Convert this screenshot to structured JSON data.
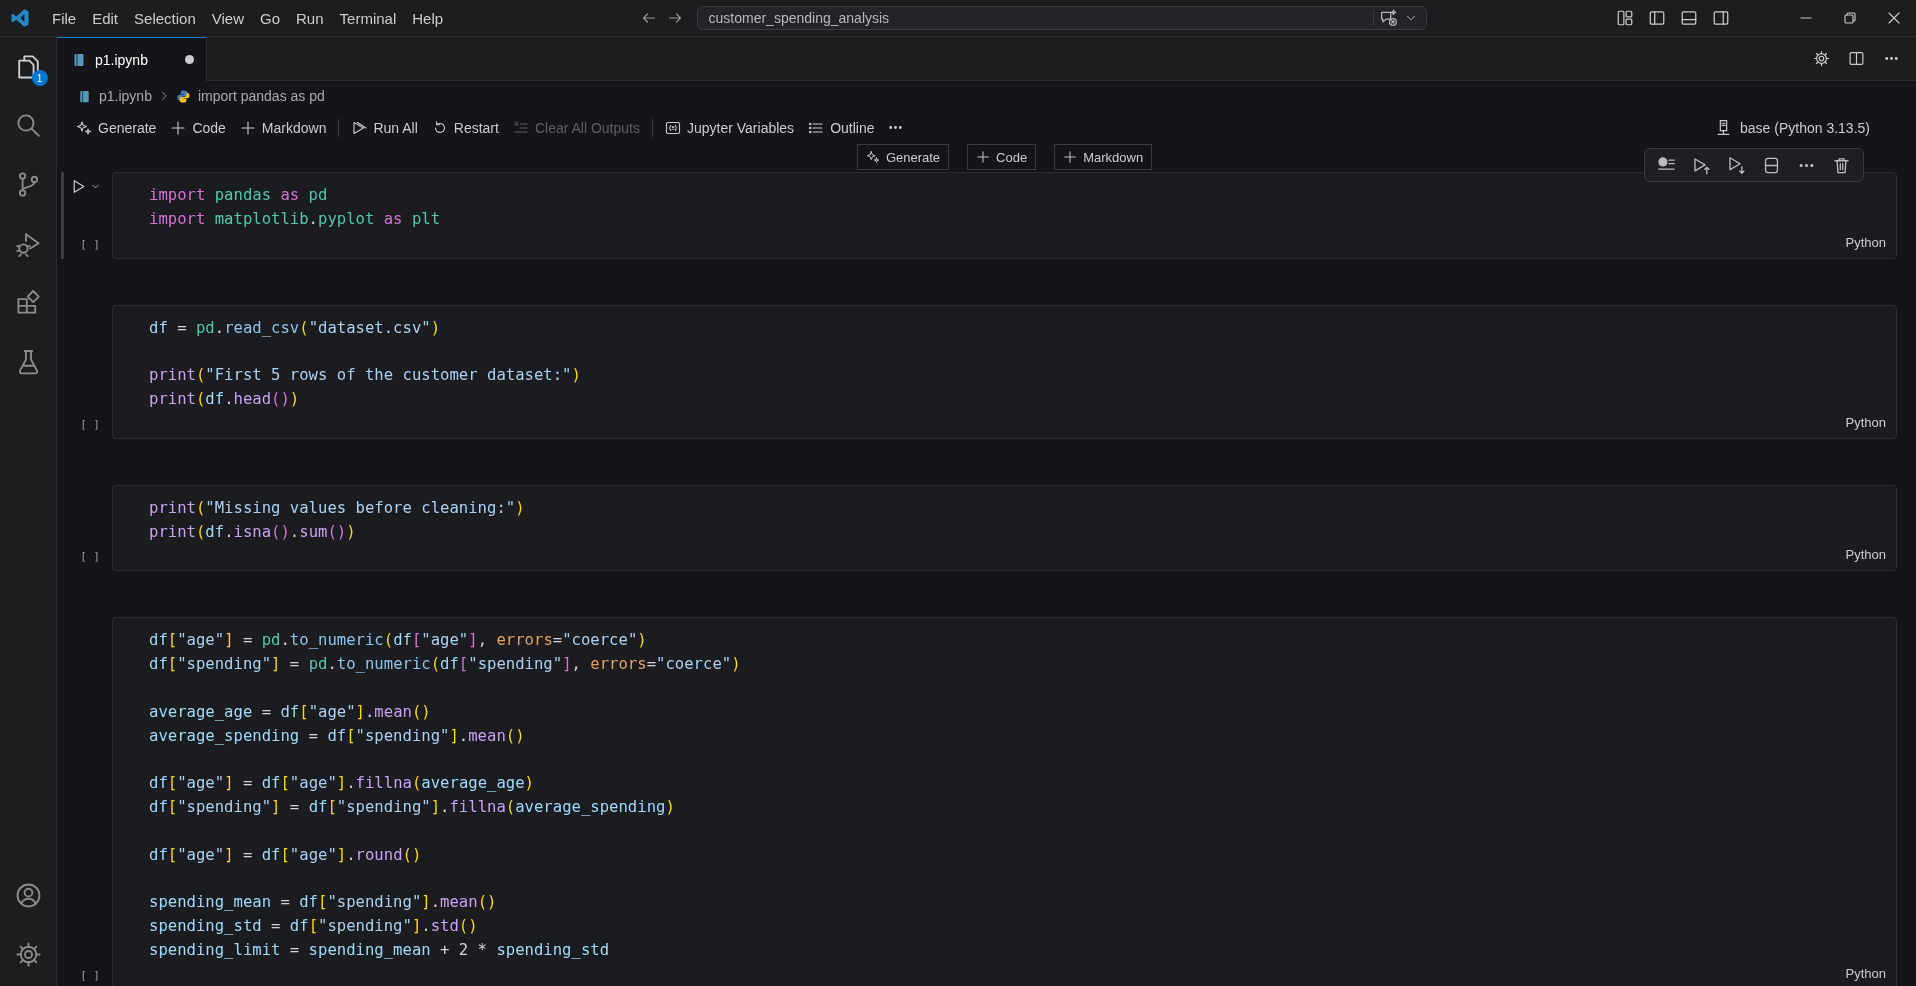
{
  "title_bar": {
    "menu": [
      "File",
      "Edit",
      "Selection",
      "View",
      "Go",
      "Run",
      "Terminal",
      "Help"
    ],
    "search": "customer_spending_analysis"
  },
  "activity_bar": {
    "explorer_badge": "1"
  },
  "tab": {
    "label": "p1.ipynb",
    "modified": true
  },
  "breadcrumb": [
    "p1.ipynb",
    "import pandas as pd"
  ],
  "toolbar": {
    "groups": [
      [
        {
          "kind": "generate",
          "label": "Generate",
          "disabled": false
        },
        {
          "kind": "code",
          "label": "Code",
          "disabled": false
        },
        {
          "kind": "markdown",
          "label": "Markdown",
          "disabled": false
        }
      ],
      [
        {
          "kind": "run_all",
          "label": "Run All",
          "disabled": false
        },
        {
          "kind": "restart",
          "label": "Restart",
          "disabled": false
        },
        {
          "kind": "clear",
          "label": "Clear All Outputs",
          "disabled": true
        }
      ],
      [
        {
          "kind": "variables",
          "label": "Jupyter Variables",
          "disabled": false
        },
        {
          "kind": "outline",
          "label": "Outline",
          "disabled": false
        }
      ]
    ],
    "kernel": "base (Python 3.13.5)"
  },
  "insert_bar": [
    {
      "kind": "generate",
      "label": "Generate"
    },
    {
      "kind": "code",
      "label": "Code"
    },
    {
      "kind": "markdown",
      "label": "Markdown"
    }
  ],
  "cells": [
    {
      "focused": true,
      "execution": "[ ]",
      "language": "Python",
      "lines": [
        {
          "kind": "code",
          "tokens": [
            {
              "kind": "kw",
              "text": "import "
            },
            {
              "kind": "mod",
              "text": "pandas "
            },
            {
              "kind": "kw",
              "text": "as "
            },
            {
              "kind": "mod",
              "text": "pd"
            }
          ]
        },
        {
          "kind": "code",
          "tokens": [
            {
              "kind": "kw",
              "text": "import "
            },
            {
              "kind": "mod",
              "text": "matplotlib"
            },
            {
              "kind": "op",
              "text": "."
            },
            {
              "kind": "mod",
              "text": "pyplot "
            },
            {
              "kind": "kw",
              "text": "as "
            },
            {
              "kind": "mod",
              "text": "plt"
            }
          ]
        }
      ]
    },
    {
      "focused": false,
      "execution": "[ ]",
      "language": "Python",
      "lines": [
        {
          "kind": "code",
          "tokens": [
            {
              "kind": "var",
              "text": "df "
            },
            {
              "kind": "op",
              "text": "= "
            },
            {
              "kind": "mod",
              "text": "pd"
            },
            {
              "kind": "op",
              "text": "."
            },
            {
              "kind": "me",
              "text": "read_csv"
            },
            {
              "kind": "b1",
              "text": "("
            },
            {
              "kind": "str",
              "text": "\"dataset.csv\""
            },
            {
              "kind": "b1",
              "text": ")"
            }
          ]
        },
        {
          "kind": "blank"
        },
        {
          "kind": "code",
          "tokens": [
            {
              "kind": "fn",
              "text": "print"
            },
            {
              "kind": "b1",
              "text": "("
            },
            {
              "kind": "str",
              "text": "\"First 5 rows of the customer dataset:\""
            },
            {
              "kind": "b1",
              "text": ")"
            }
          ]
        },
        {
          "kind": "code",
          "tokens": [
            {
              "kind": "fn",
              "text": "print"
            },
            {
              "kind": "b1",
              "text": "("
            },
            {
              "kind": "var",
              "text": "df"
            },
            {
              "kind": "op",
              "text": "."
            },
            {
              "kind": "fn",
              "text": "head"
            },
            {
              "kind": "b2",
              "text": "()"
            },
            {
              "kind": "b1",
              "text": ")"
            }
          ]
        }
      ]
    },
    {
      "focused": false,
      "execution": "[ ]",
      "language": "Python",
      "lines": [
        {
          "kind": "code",
          "tokens": [
            {
              "kind": "fn",
              "text": "print"
            },
            {
              "kind": "b1",
              "text": "("
            },
            {
              "kind": "str",
              "text": "\"Missing values before cleaning:\""
            },
            {
              "kind": "b1",
              "text": ")"
            }
          ]
        },
        {
          "kind": "code",
          "tokens": [
            {
              "kind": "fn",
              "text": "print"
            },
            {
              "kind": "b1",
              "text": "("
            },
            {
              "kind": "var",
              "text": "df"
            },
            {
              "kind": "op",
              "text": "."
            },
            {
              "kind": "fn",
              "text": "isna"
            },
            {
              "kind": "b2",
              "text": "()"
            },
            {
              "kind": "op",
              "text": "."
            },
            {
              "kind": "fn",
              "text": "sum"
            },
            {
              "kind": "b2",
              "text": "()"
            },
            {
              "kind": "b1",
              "text": ")"
            }
          ]
        }
      ]
    },
    {
      "focused": false,
      "execution": "[ ]",
      "language": "Python",
      "lines": [
        {
          "kind": "code",
          "tokens": [
            {
              "kind": "var",
              "text": "df"
            },
            {
              "kind": "b1",
              "text": "["
            },
            {
              "kind": "str",
              "text": "\"age\""
            },
            {
              "kind": "b1",
              "text": "]"
            },
            {
              "kind": "op",
              "text": " = "
            },
            {
              "kind": "mod",
              "text": "pd"
            },
            {
              "kind": "op",
              "text": "."
            },
            {
              "kind": "me",
              "text": "to_numeric"
            },
            {
              "kind": "b1",
              "text": "("
            },
            {
              "kind": "var",
              "text": "df"
            },
            {
              "kind": "b2",
              "text": "["
            },
            {
              "kind": "str",
              "text": "\"age\""
            },
            {
              "kind": "b2",
              "text": "]"
            },
            {
              "kind": "op",
              "text": ", "
            },
            {
              "kind": "pa",
              "text": "errors"
            },
            {
              "kind": "op",
              "text": "="
            },
            {
              "kind": "str",
              "text": "\"coerce\""
            },
            {
              "kind": "b1",
              "text": ")"
            }
          ]
        },
        {
          "kind": "code",
          "tokens": [
            {
              "kind": "var",
              "text": "df"
            },
            {
              "kind": "b1",
              "text": "["
            },
            {
              "kind": "str",
              "text": "\"spending\""
            },
            {
              "kind": "b1",
              "text": "]"
            },
            {
              "kind": "op",
              "text": " = "
            },
            {
              "kind": "mod",
              "text": "pd"
            },
            {
              "kind": "op",
              "text": "."
            },
            {
              "kind": "me",
              "text": "to_numeric"
            },
            {
              "kind": "b1",
              "text": "("
            },
            {
              "kind": "var",
              "text": "df"
            },
            {
              "kind": "b2",
              "text": "["
            },
            {
              "kind": "str",
              "text": "\"spending\""
            },
            {
              "kind": "b2",
              "text": "]"
            },
            {
              "kind": "op",
              "text": ", "
            },
            {
              "kind": "pa",
              "text": "errors"
            },
            {
              "kind": "op",
              "text": "="
            },
            {
              "kind": "str",
              "text": "\"coerce\""
            },
            {
              "kind": "b1",
              "text": ")"
            }
          ]
        },
        {
          "kind": "blank"
        },
        {
          "kind": "code",
          "tokens": [
            {
              "kind": "var",
              "text": "average_age"
            },
            {
              "kind": "op",
              "text": " = "
            },
            {
              "kind": "var",
              "text": "df"
            },
            {
              "kind": "b1",
              "text": "["
            },
            {
              "kind": "str",
              "text": "\"age\""
            },
            {
              "kind": "b1",
              "text": "]"
            },
            {
              "kind": "op",
              "text": "."
            },
            {
              "kind": "fn",
              "text": "mean"
            },
            {
              "kind": "b1",
              "text": "()"
            }
          ]
        },
        {
          "kind": "code",
          "tokens": [
            {
              "kind": "var",
              "text": "average_spending"
            },
            {
              "kind": "op",
              "text": " = "
            },
            {
              "kind": "var",
              "text": "df"
            },
            {
              "kind": "b1",
              "text": "["
            },
            {
              "kind": "str",
              "text": "\"spending\""
            },
            {
              "kind": "b1",
              "text": "]"
            },
            {
              "kind": "op",
              "text": "."
            },
            {
              "kind": "fn",
              "text": "mean"
            },
            {
              "kind": "b1",
              "text": "()"
            }
          ]
        },
        {
          "kind": "blank"
        },
        {
          "kind": "code",
          "tokens": [
            {
              "kind": "var",
              "text": "df"
            },
            {
              "kind": "b1",
              "text": "["
            },
            {
              "kind": "str",
              "text": "\"age\""
            },
            {
              "kind": "b1",
              "text": "]"
            },
            {
              "kind": "op",
              "text": " = "
            },
            {
              "kind": "var",
              "text": "df"
            },
            {
              "kind": "b1",
              "text": "["
            },
            {
              "kind": "str",
              "text": "\"age\""
            },
            {
              "kind": "b1",
              "text": "]"
            },
            {
              "kind": "op",
              "text": "."
            },
            {
              "kind": "fn",
              "text": "fillna"
            },
            {
              "kind": "b1",
              "text": "("
            },
            {
              "kind": "var",
              "text": "average_age"
            },
            {
              "kind": "b1",
              "text": ")"
            }
          ]
        },
        {
          "kind": "code",
          "tokens": [
            {
              "kind": "var",
              "text": "df"
            },
            {
              "kind": "b1",
              "text": "["
            },
            {
              "kind": "str",
              "text": "\"spending\""
            },
            {
              "kind": "b1",
              "text": "]"
            },
            {
              "kind": "op",
              "text": " = "
            },
            {
              "kind": "var",
              "text": "df"
            },
            {
              "kind": "b1",
              "text": "["
            },
            {
              "kind": "str",
              "text": "\"spending\""
            },
            {
              "kind": "b1",
              "text": "]"
            },
            {
              "kind": "op",
              "text": "."
            },
            {
              "kind": "fn",
              "text": "fillna"
            },
            {
              "kind": "b1",
              "text": "("
            },
            {
              "kind": "var",
              "text": "average_spending"
            },
            {
              "kind": "b1",
              "text": ")"
            }
          ]
        },
        {
          "kind": "blank"
        },
        {
          "kind": "code",
          "tokens": [
            {
              "kind": "var",
              "text": "df"
            },
            {
              "kind": "b1",
              "text": "["
            },
            {
              "kind": "str",
              "text": "\"age\""
            },
            {
              "kind": "b1",
              "text": "]"
            },
            {
              "kind": "op",
              "text": " = "
            },
            {
              "kind": "var",
              "text": "df"
            },
            {
              "kind": "b1",
              "text": "["
            },
            {
              "kind": "str",
              "text": "\"age\""
            },
            {
              "kind": "b1",
              "text": "]"
            },
            {
              "kind": "op",
              "text": "."
            },
            {
              "kind": "fn",
              "text": "round"
            },
            {
              "kind": "b1",
              "text": "()"
            }
          ]
        },
        {
          "kind": "blank"
        },
        {
          "kind": "code",
          "tokens": [
            {
              "kind": "var",
              "text": "spending_mean"
            },
            {
              "kind": "op",
              "text": " = "
            },
            {
              "kind": "var",
              "text": "df"
            },
            {
              "kind": "b1",
              "text": "["
            },
            {
              "kind": "str",
              "text": "\"spending\""
            },
            {
              "kind": "b1",
              "text": "]"
            },
            {
              "kind": "op",
              "text": "."
            },
            {
              "kind": "fn",
              "text": "mean"
            },
            {
              "kind": "b1",
              "text": "()"
            }
          ]
        },
        {
          "kind": "code",
          "tokens": [
            {
              "kind": "var",
              "text": "spending_std"
            },
            {
              "kind": "op",
              "text": " = "
            },
            {
              "kind": "var",
              "text": "df"
            },
            {
              "kind": "b1",
              "text": "["
            },
            {
              "kind": "str",
              "text": "\"spending\""
            },
            {
              "kind": "b1",
              "text": "]"
            },
            {
              "kind": "op",
              "text": "."
            },
            {
              "kind": "fn",
              "text": "std"
            },
            {
              "kind": "b1",
              "text": "()"
            }
          ]
        },
        {
          "kind": "code",
          "tokens": [
            {
              "kind": "var",
              "text": "spending_limit"
            },
            {
              "kind": "op",
              "text": " = "
            },
            {
              "kind": "var",
              "text": "spending_mean"
            },
            {
              "kind": "op",
              "text": " + 2 * "
            },
            {
              "kind": "var",
              "text": "spending_std"
            }
          ]
        }
      ]
    }
  ]
}
